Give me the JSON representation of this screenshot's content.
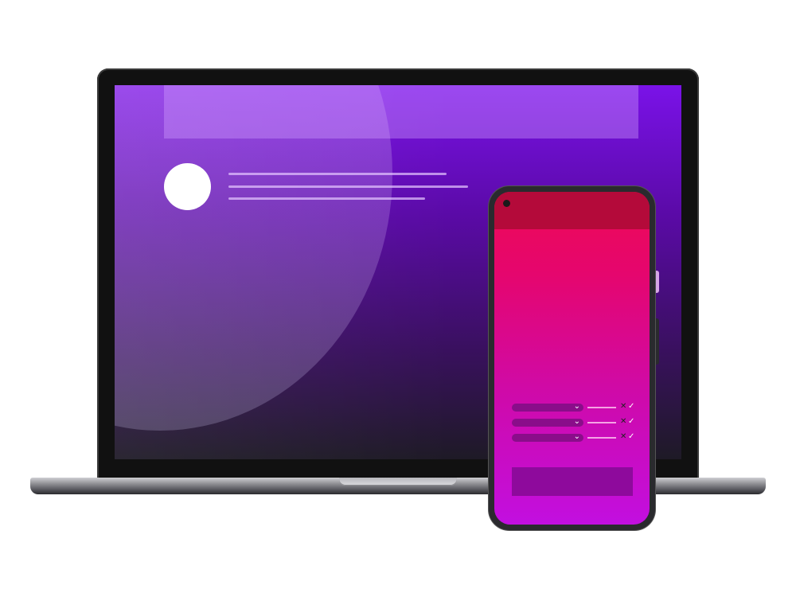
{
  "laptop": {
    "screen": {
      "header_bar": "",
      "profile_lines": 3
    }
  },
  "phone": {
    "form_rows": [
      {
        "chevron": "chevron-down-icon",
        "status_icons": [
          "close-icon",
          "check-icon"
        ]
      },
      {
        "chevron": "chevron-down-icon",
        "status_icons": [
          "close-icon",
          "check-icon"
        ]
      },
      {
        "chevron": "chevron-down-icon",
        "status_icons": [
          "close-icon",
          "check-icon"
        ]
      }
    ],
    "submit_button_label": ""
  },
  "colors": {
    "laptop_gradient_top": "#7a12e8",
    "laptop_gradient_bottom": "#1e1a26",
    "phone_topbar": "#b40a3a",
    "phone_gradient_top": "#ee0a55",
    "phone_gradient_bottom": "#c20fe0",
    "phone_button": "#8e0a9c"
  }
}
